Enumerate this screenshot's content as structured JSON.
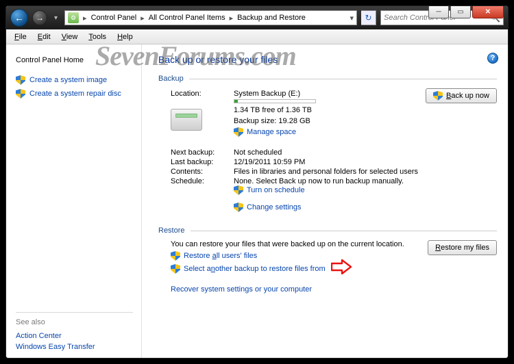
{
  "breadcrumb": {
    "items": [
      "Control Panel",
      "All Control Panel Items",
      "Backup and Restore"
    ]
  },
  "search": {
    "placeholder": "Search Control Panel"
  },
  "menubar": {
    "file": "File",
    "edit": "Edit",
    "view": "View",
    "tools": "Tools",
    "help": "Help"
  },
  "watermark": "SevenForums.com",
  "sidebar": {
    "home": "Control Panel Home",
    "create_image": "Create a system image",
    "create_repair": "Create a system repair disc",
    "see_also_hdr": "See also",
    "action_center": "Action Center",
    "easy_transfer": "Windows Easy Transfer"
  },
  "main": {
    "title": "Back up or restore your files",
    "backup": {
      "legend": "Backup",
      "location_label": "Location:",
      "location_value": "System Backup (E:)",
      "free_space": "1.34 TB free of 1.36 TB",
      "backup_size": "Backup size: 19.28 GB",
      "manage_space": "Manage space",
      "backup_now_btn": "Back up now",
      "next_backup_label": "Next backup:",
      "next_backup_value": "Not scheduled",
      "last_backup_label": "Last backup:",
      "last_backup_value": "12/19/2011 10:59 PM",
      "contents_label": "Contents:",
      "contents_value": "Files in libraries and personal folders for selected users",
      "schedule_label": "Schedule:",
      "schedule_value": "None. Select Back up now to run backup manually.",
      "turn_on_schedule": "Turn on schedule",
      "change_settings": "Change settings"
    },
    "restore": {
      "legend": "Restore",
      "desc": "You can restore your files that were backed up on the current location.",
      "restore_all": "Restore all users' files",
      "select_another": "Select another backup to restore files from",
      "restore_my_files_btn": "Restore my files",
      "recover_system": "Recover system settings or your computer"
    }
  }
}
